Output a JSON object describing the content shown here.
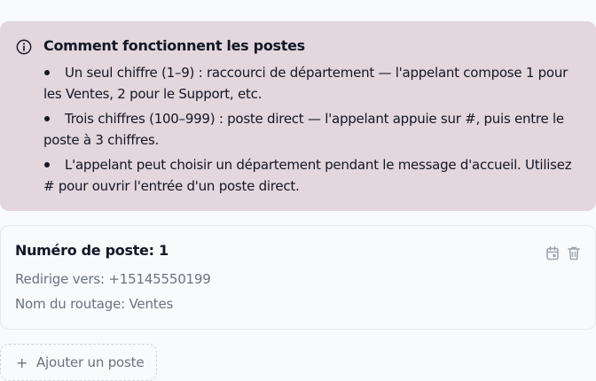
{
  "info": {
    "icon": "info-circle-icon",
    "title": "Comment fonctionnent les postes",
    "bullets": [
      "Un seul chiffre (1–9) : raccourci de département — l'appelant compose 1 pour les Ventes, 2 pour le Support, etc.",
      "Trois chiffres (100–999) : poste direct — l'appelant appuie sur #, puis entre le poste à 3 chiffres.",
      "L'appelant peut choisir un département pendant le message d'accueil. Utilisez # pour ouvrir l'entrée d'un poste direct."
    ]
  },
  "extension_card": {
    "title": "Numéro de poste: 1",
    "forward_to": "Redirige vers: +15145550199",
    "route_name": "Nom du routage: Ventes",
    "actions": [
      "calendar-icon",
      "trash-icon"
    ]
  },
  "add_button": {
    "icon": "plus-icon",
    "label": "Ajouter un poste"
  }
}
